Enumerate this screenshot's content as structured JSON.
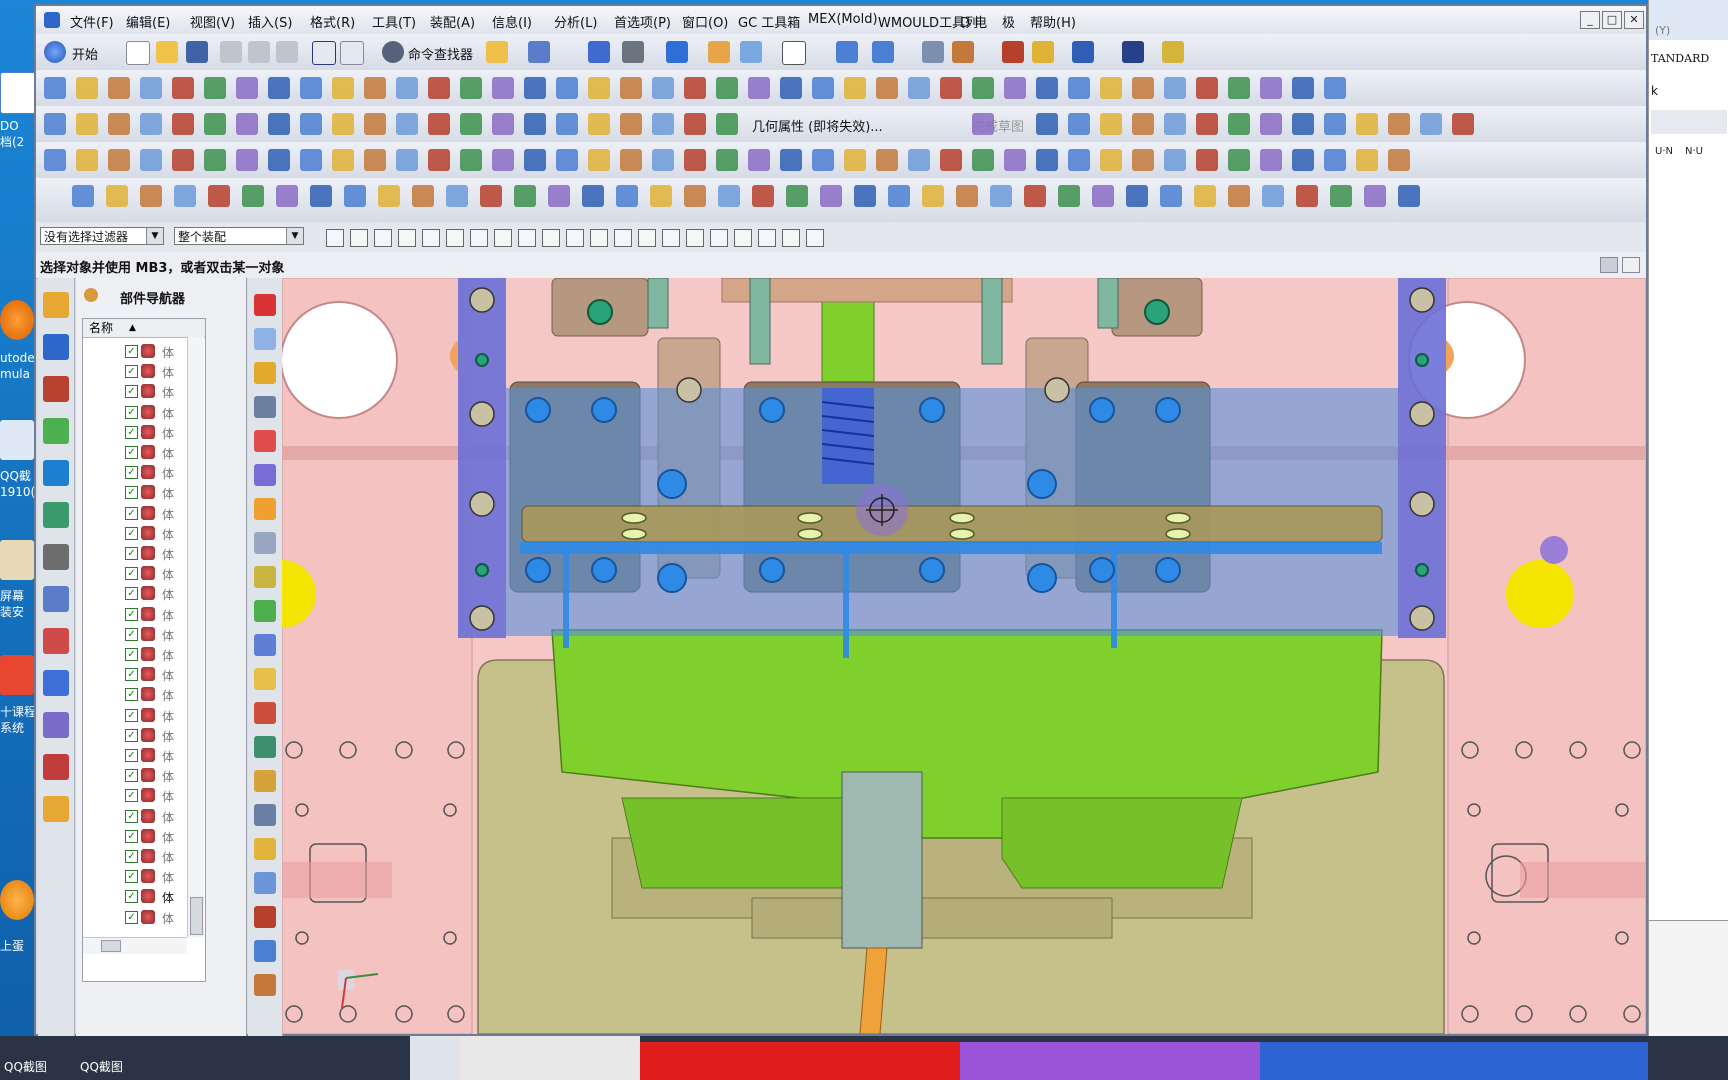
{
  "window": {
    "menus": [
      "文件(F)",
      "编辑(E)",
      "视图(V)",
      "插入(S)",
      "格式(R)",
      "工具(T)",
      "装配(A)",
      "信息(I)",
      "分析(L)",
      "首选项(P)",
      "窗口(O)",
      "GC 工具箱",
      "MEX(Mold)",
      "WMOULD工具列",
      "D 电",
      "极",
      "帮助(H)"
    ],
    "controls": {
      "min": "_",
      "max": "□",
      "close": "✕"
    }
  },
  "toolbar": {
    "start_label": "开始",
    "command_finder_label": "命令查找器",
    "geometry_property_label": "几何属性 (即将失效)...",
    "finish_sketch_label": "完成草图"
  },
  "filterbar": {
    "selection_filter": "没有选择过滤器",
    "assembly_scope": "整个装配"
  },
  "status": {
    "prompt": "选择对象并使用 MB3，或者双击某一对象"
  },
  "navigator": {
    "title": "部件导航器",
    "column_name": "名称",
    "items": [
      "体",
      "体",
      "体",
      "体",
      "体",
      "体",
      "体",
      "体",
      "体",
      "体",
      "体",
      "体",
      "体",
      "体",
      "体",
      "体",
      "体",
      "体",
      "体",
      "体",
      "体",
      "体",
      "体",
      "体",
      "体",
      "体",
      "体",
      "体",
      "体"
    ],
    "highlighted_index": 27
  },
  "desktop": {
    "labels": [
      "DO",
      "档(2",
      "utode",
      "mula",
      "QQ截",
      "1910(",
      "屏幕",
      "装安",
      "十课程",
      "系统",
      "上蛋",
      "QQ截图",
      "QQ截图"
    ]
  },
  "bgwindow": {
    "text1": "(Y)",
    "text2": "TANDARD",
    "text3": "k",
    "text4": "U·N",
    "text5": "N·U"
  },
  "colors": {
    "accent_blue": "#5b8fd8",
    "pink_plate": "#f6c7c7",
    "green_part": "#7fd02c",
    "olive_part": "#c6c08a",
    "yellow_hole": "#f5e400"
  }
}
